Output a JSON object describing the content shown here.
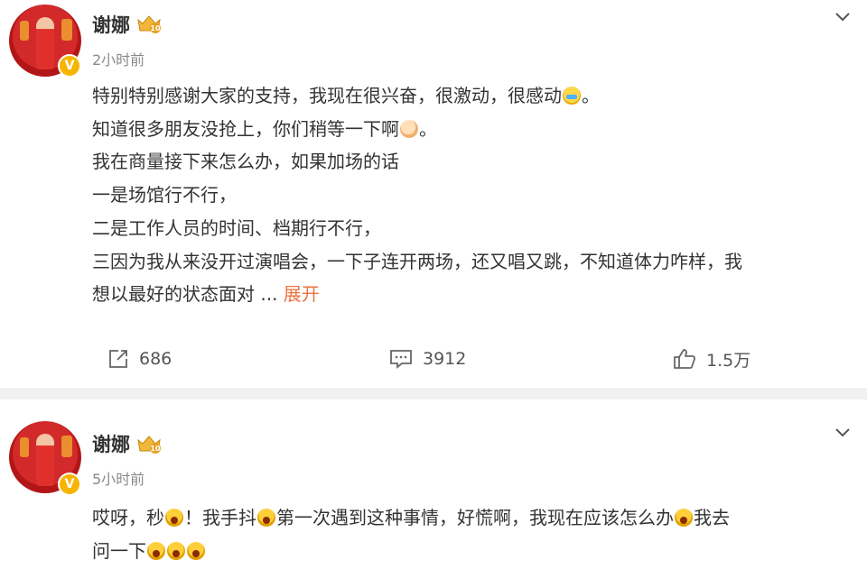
{
  "posts": [
    {
      "username": "谢娜",
      "time": "2小时前",
      "lines": [
        "特别特别感谢大家的支持，我现在很兴奋，很激动，很感动",
        "。",
        "知道很多朋友没抢上，你们稍等一下啊",
        "。",
        "我在商量接下来怎么办，如果加场的话",
        "一是场馆行不行，",
        "二是工作人员的时间、档期行不行，",
        "三因为我从来没开过演唱会，一下子连开两场，还又唱又跳，不知道体力咋样，我",
        "想以最好的状态面对 ..."
      ],
      "expand_label": "展开",
      "repost_count": "686",
      "comment_count": "3912",
      "like_count": "1.5万",
      "badge_text": "V",
      "level_text": "10"
    },
    {
      "username": "谢娜",
      "time": "5小时前",
      "lines": [
        "哎呀，秒",
        "！我手抖",
        "第一次遇到这种事情，好慌啊，我现在应该怎么办",
        "我去",
        "问一下"
      ],
      "badge_text": "V",
      "level_text": "10"
    }
  ],
  "icons": {
    "repost": "repost-icon",
    "comment": "comment-icon",
    "like": "thumbs-up-icon",
    "more": "chevron-down-icon"
  },
  "colors": {
    "expand": "#eb7340",
    "divider": "#f1f1f1",
    "verified_badge": "#f7b500"
  }
}
